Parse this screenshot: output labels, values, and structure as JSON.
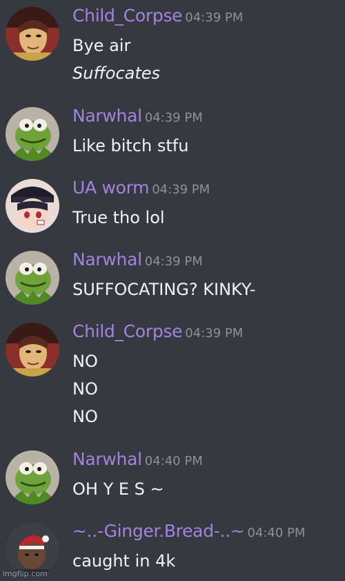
{
  "messages": [
    {
      "username": "Child_Corpse",
      "time": "04:39 PM",
      "lines": [
        "Bye air",
        "Suffocates"
      ],
      "avatar": "child-corpse-avatar"
    },
    {
      "username": "Narwhal",
      "time": "04:39 PM",
      "lines": [
        "Like bitch stfu"
      ],
      "avatar": "kermit-avatar"
    },
    {
      "username": "UA worm",
      "time": "04:39 PM",
      "lines": [
        "True tho lol"
      ],
      "avatar": "ua-worm-avatar"
    },
    {
      "username": "Narwhal",
      "time": "04:39 PM",
      "lines": [
        "SUFFOCATING? KINKY-"
      ],
      "avatar": "kermit-avatar"
    },
    {
      "username": "Child_Corpse",
      "time": "04:39 PM",
      "lines": [
        "NO",
        "NO",
        "NO"
      ],
      "avatar": "child-corpse-avatar"
    },
    {
      "username": "Narwhal",
      "time": "04:40 PM",
      "lines": [
        "OH Y E S ~"
      ],
      "avatar": "kermit-avatar"
    },
    {
      "username": "~..-Ginger.Bread-..~",
      "time": "04:40 PM",
      "lines": [
        "caught in 4k"
      ],
      "avatar": "ginger-bread-avatar"
    }
  ],
  "watermark": "imgflip.com",
  "colors": {
    "background": "#36393f",
    "username": "#a284e0",
    "timestamp": "#8e9297",
    "text": "#f2f3f5"
  }
}
